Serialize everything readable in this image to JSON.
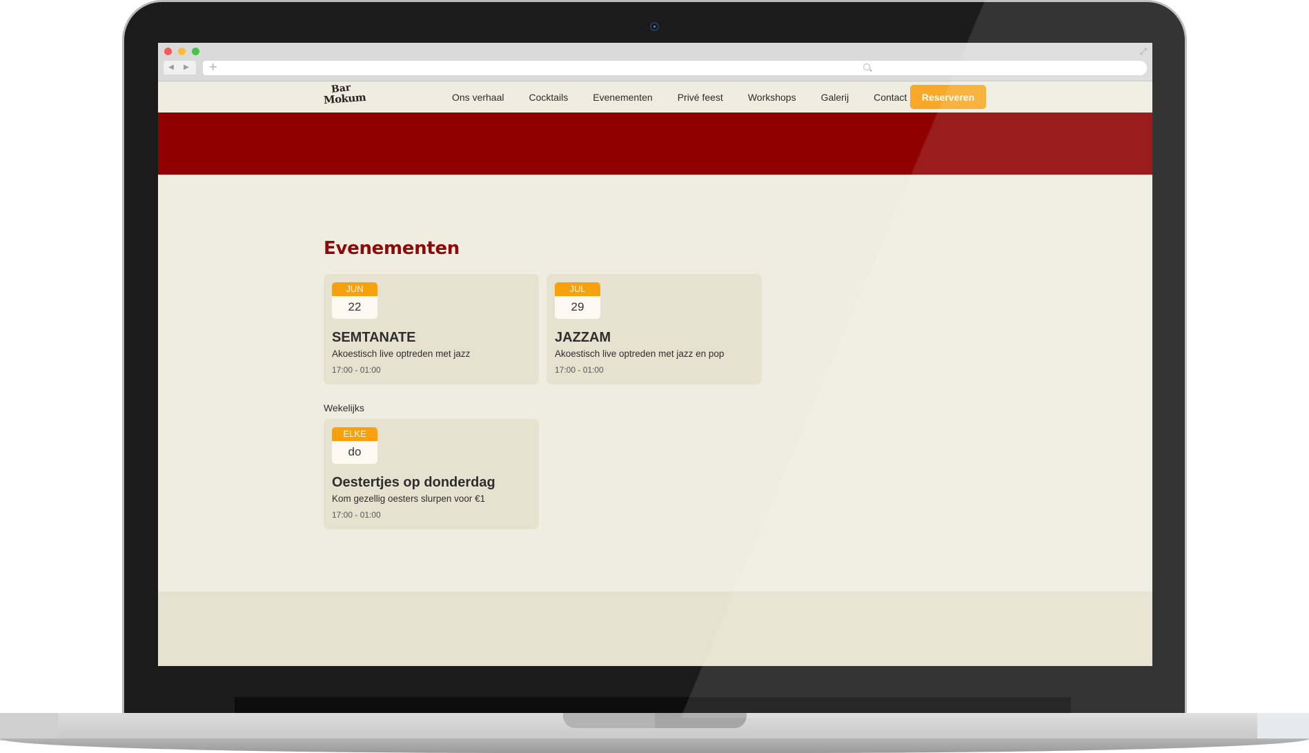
{
  "site": {
    "logo_line1": "Bar",
    "logo_line2": "Mokum",
    "nav": [
      "Ons verhaal",
      "Cocktails",
      "Evenementen",
      "Privé feest",
      "Workshops",
      "Galerij",
      "Contact"
    ],
    "cta_label": "Reserveren"
  },
  "colors": {
    "accent": "#f7a829",
    "brand_red": "#8f0000",
    "background": "#efece0",
    "card": "#e6e2cf"
  },
  "events": {
    "title": "Evenementen",
    "items": [
      {
        "month": "JUN",
        "day": "22",
        "name": "SEMTANATE",
        "description": "Akoestisch live optreden met jazz",
        "time": "17:00 - 01:00"
      },
      {
        "month": "JUL",
        "day": "29",
        "name": "JAZZAM",
        "description": "Akoestisch live optreden met jazz en pop",
        "time": "17:00 - 01:00"
      }
    ],
    "weekly_label": "Wekelijks",
    "weekly": [
      {
        "month": "ELKE",
        "day": "do",
        "name": "Oestertjes op donderdag",
        "description": "Kom gezellig oesters slurpen voor €1",
        "time": "17:00 - 01:00"
      }
    ]
  },
  "icons": [
    "back-arrow-icon",
    "forward-arrow-icon",
    "plus-icon",
    "search-icon",
    "expand-icon",
    "camera-icon"
  ]
}
